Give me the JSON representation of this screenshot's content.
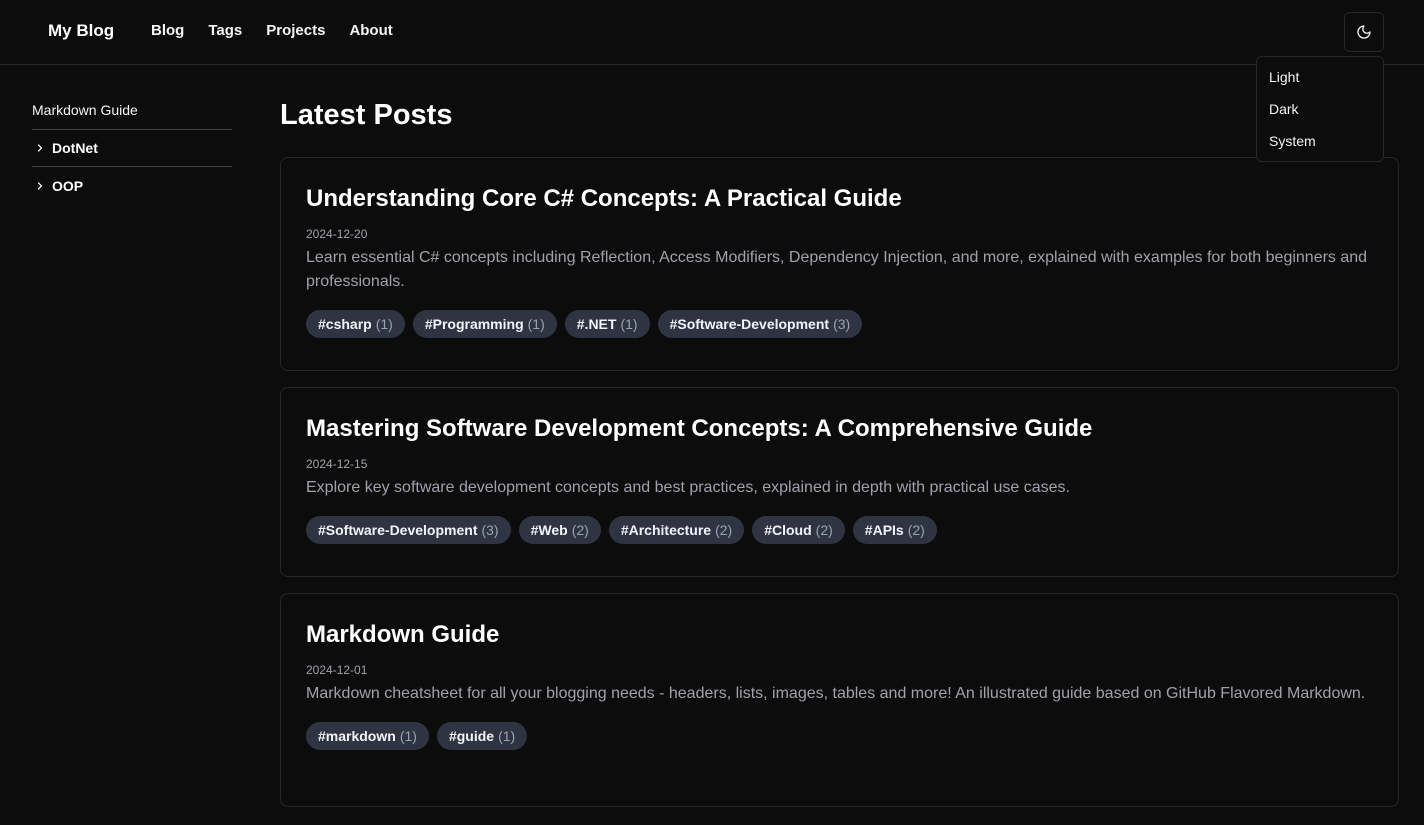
{
  "header": {
    "brand": "My Blog",
    "nav": [
      "Blog",
      "Tags",
      "Projects",
      "About"
    ],
    "theme_toggle_icon": "moon-icon",
    "theme_menu": [
      "Light",
      "Dark",
      "System"
    ]
  },
  "sidebar": {
    "top_link": "Markdown Guide",
    "groups": [
      {
        "label": "DotNet",
        "icon": "chevron-right-icon"
      },
      {
        "label": "OOP",
        "icon": "chevron-right-icon"
      }
    ]
  },
  "main": {
    "title": "Latest Posts",
    "posts": [
      {
        "title": "Understanding Core C# Concepts: A Practical Guide",
        "date": "2024-12-20",
        "description": "Learn essential C# concepts including Reflection, Access Modifiers, Dependency Injection, and more, explained with examples for both beginners and professionals.",
        "tags": [
          {
            "name": "#csharp",
            "count": "(1)"
          },
          {
            "name": "#Programming",
            "count": "(1)"
          },
          {
            "name": "#.NET",
            "count": "(1)"
          },
          {
            "name": "#Software-Development",
            "count": "(3)"
          }
        ]
      },
      {
        "title": "Mastering Software Development Concepts: A Comprehensive Guide",
        "date": "2024-12-15",
        "description": "Explore key software development concepts and best practices, explained in depth with practical use cases.",
        "tags": [
          {
            "name": "#Software-Development",
            "count": "(3)"
          },
          {
            "name": "#Web",
            "count": "(2)"
          },
          {
            "name": "#Architecture",
            "count": "(2)"
          },
          {
            "name": "#Cloud",
            "count": "(2)"
          },
          {
            "name": "#APIs",
            "count": "(2)"
          }
        ]
      },
      {
        "title": "Markdown Guide",
        "date": "2024-12-01",
        "description": "Markdown cheatsheet for all your blogging needs - headers, lists, images, tables and more! An illustrated guide based on GitHub Flavored Markdown.",
        "tags": [
          {
            "name": "#markdown",
            "count": "(1)"
          },
          {
            "name": "#guide",
            "count": "(1)"
          }
        ]
      }
    ]
  },
  "colors": {
    "background": "#0c0c0d",
    "border": "#27272a",
    "muted_text": "#a1a1aa",
    "tag_background": "#2e3442"
  }
}
